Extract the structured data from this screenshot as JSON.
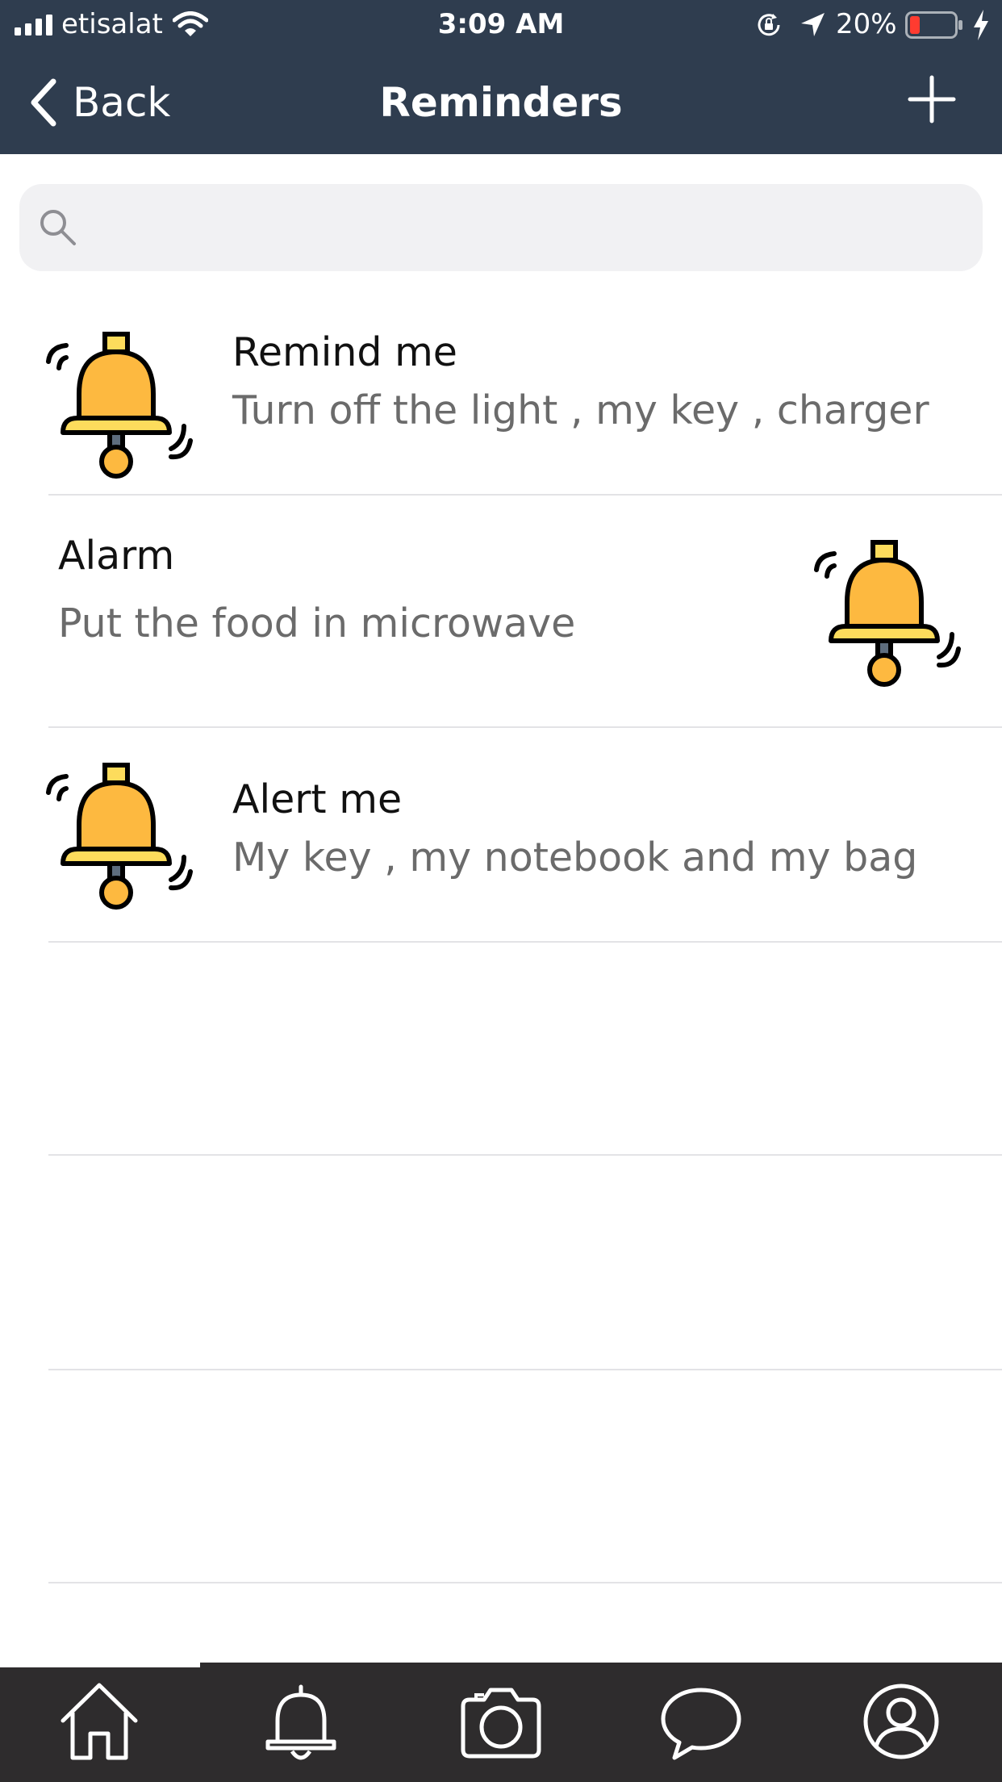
{
  "status_bar": {
    "carrier": "etisalat",
    "time": "3:09 AM",
    "battery_percent": "20%"
  },
  "nav": {
    "back_label": "Back",
    "title": "Reminders"
  },
  "search": {
    "placeholder": "",
    "value": ""
  },
  "reminders": [
    {
      "title": "Remind me",
      "subtitle": "Turn off the light , my key , charger"
    },
    {
      "title": "Alarm",
      "subtitle": "Put the food in microwave"
    },
    {
      "title": "Alert me",
      "subtitle": "My key , my notebook and my bag"
    }
  ],
  "tabs": [
    {
      "icon": "home-icon"
    },
    {
      "icon": "bell-icon"
    },
    {
      "icon": "camera-icon"
    },
    {
      "icon": "chat-bubble-icon"
    },
    {
      "icon": "profile-icon"
    }
  ],
  "colors": {
    "header_bg": "#2f3d4f",
    "tabbar_bg": "#2e2c2d",
    "bell_yellow": "#fdb940",
    "bell_base": "#fddc5c",
    "battery_low": "#ff3b30"
  }
}
